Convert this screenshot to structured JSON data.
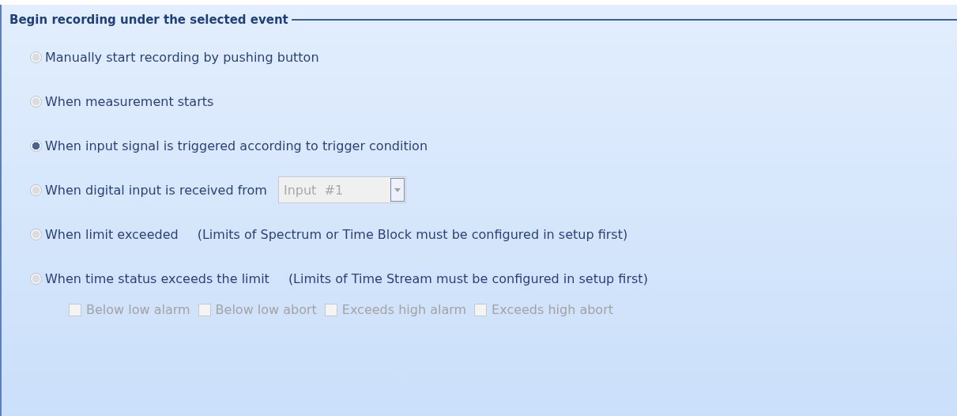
{
  "group": {
    "title": "Begin recording under the selected event",
    "options": [
      {
        "label": "Manually start recording by pushing button",
        "selected": false
      },
      {
        "label": "When measurement starts",
        "selected": false
      },
      {
        "label": "When input signal is triggered according to trigger condition",
        "selected": true
      },
      {
        "label": "When digital input is received from",
        "selected": false,
        "dropdown": {
          "value": "Input  #1",
          "disabled": true
        }
      },
      {
        "label": "When limit exceeded",
        "selected": false,
        "note": "(Limits of Spectrum or Time Block must be configured in setup first)"
      },
      {
        "label": "When time status exceeds the limit",
        "selected": false,
        "note": "(Limits of Time Stream must be configured in setup first)"
      }
    ],
    "limits": [
      {
        "label": "Below low alarm",
        "checked": false,
        "disabled": true
      },
      {
        "label": "Below low abort",
        "checked": false,
        "disabled": true
      },
      {
        "label": "Exceeds high alarm",
        "checked": false,
        "disabled": true
      },
      {
        "label": "Exceeds high abort",
        "checked": false,
        "disabled": true
      }
    ]
  }
}
